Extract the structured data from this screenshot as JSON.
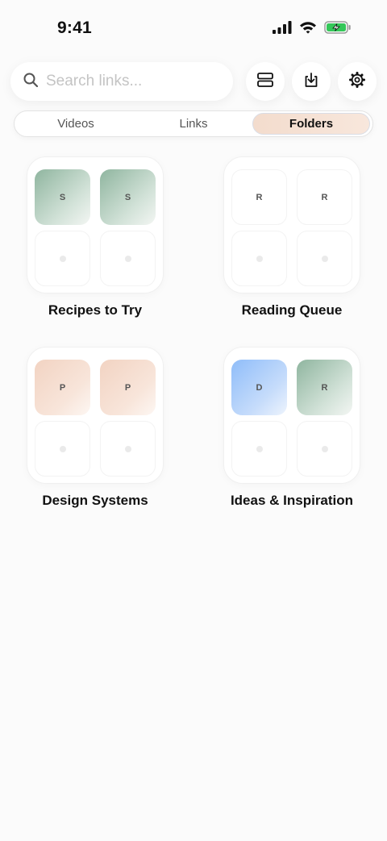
{
  "status_bar": {
    "time": "9:41",
    "icons": [
      "cellular-signal-icon",
      "wifi-icon",
      "battery-charging-icon"
    ],
    "battery_color": "#34c759"
  },
  "search": {
    "placeholder": "Search links...",
    "icon": "search-icon"
  },
  "toolbar": {
    "buttons": [
      {
        "name": "layout-toggle-button",
        "icon": "rows-layout-icon"
      },
      {
        "name": "import-button",
        "icon": "download-tray-icon"
      },
      {
        "name": "settings-button",
        "icon": "gear-icon"
      }
    ]
  },
  "tabs": [
    {
      "label": "Videos",
      "active": false
    },
    {
      "label": "Links",
      "active": false
    },
    {
      "label": "Folders",
      "active": true
    }
  ],
  "accent": {
    "active_tab_fill": "#f3dccd",
    "green_tile": "#8fb59f",
    "peach_tile": "#f2d3c2",
    "blue_tile": "#8fbdf9"
  },
  "folders": [
    {
      "name": "Recipes to Try",
      "tiles": [
        {
          "letter": "S",
          "color": "green"
        },
        {
          "letter": "S",
          "color": "green"
        }
      ]
    },
    {
      "name": "Reading Queue",
      "tiles": [
        {
          "letter": "R",
          "color": "blank"
        },
        {
          "letter": "R",
          "color": "blank"
        }
      ]
    },
    {
      "name": "Design Systems",
      "tiles": [
        {
          "letter": "P",
          "color": "peach"
        },
        {
          "letter": "P",
          "color": "peach"
        }
      ]
    },
    {
      "name": "Ideas & Inspiration",
      "tiles": [
        {
          "letter": "D",
          "color": "blue"
        },
        {
          "letter": "R",
          "color": "green"
        }
      ]
    }
  ]
}
